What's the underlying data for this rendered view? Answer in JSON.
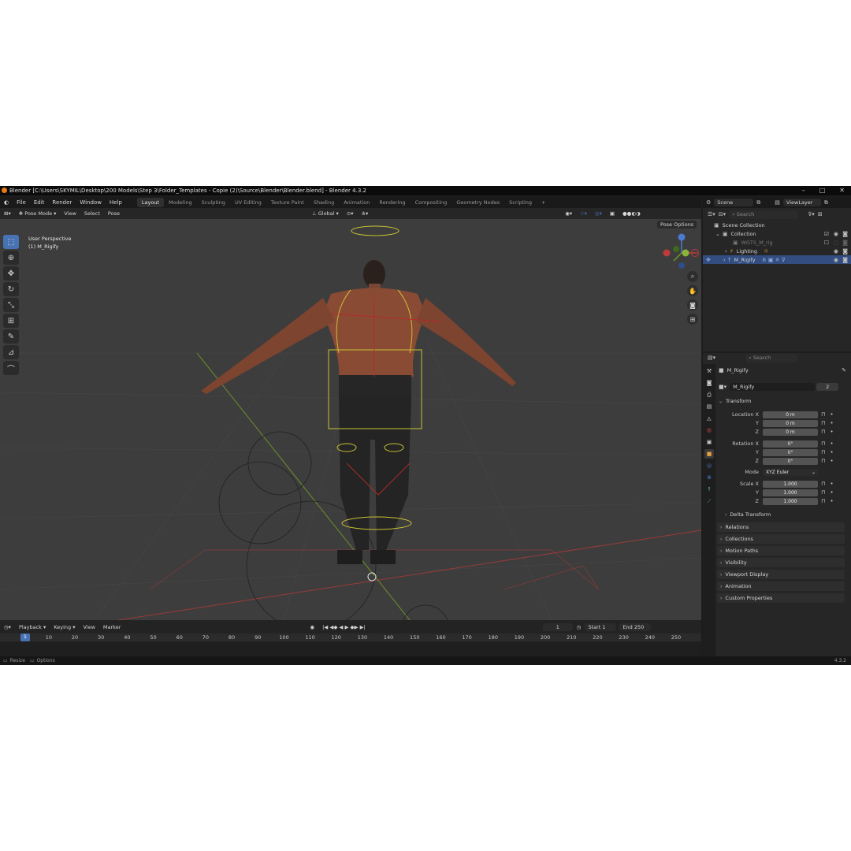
{
  "window": {
    "title": "Blender [C:\\Users\\SKYMIL\\Desktop\\200 Models\\Step 3\\Folder_Templates - Copie (2)\\Source\\Blender\\Blender.blend] - Blender 4.3.2"
  },
  "menu": [
    "File",
    "Edit",
    "Render",
    "Window",
    "Help"
  ],
  "workspaces": [
    "Layout",
    "Modeling",
    "Sculpting",
    "UV Editing",
    "Texture Paint",
    "Shading",
    "Animation",
    "Rendering",
    "Compositing",
    "Geometry Nodes",
    "Scripting"
  ],
  "scene": {
    "name": "Scene",
    "view_layer": "ViewLayer"
  },
  "header3d": {
    "mode": "Pose Mode",
    "items": [
      "View",
      "Select",
      "Pose"
    ],
    "orientation": "Global"
  },
  "viewport": {
    "perspective": "User Perspective",
    "object": "(1) M_Rigify",
    "pose_options": "Pose Options"
  },
  "outliner": {
    "search_placeholder": "Search",
    "rows": [
      "Scene Collection",
      "Collection",
      "WGTS_M_rig",
      "Lighting",
      "M_Rigify"
    ]
  },
  "properties": {
    "search_placeholder": "Search",
    "object_name": "M_Rigify",
    "data_name": "M_Rigify",
    "users": "2",
    "transform_label": "Transform",
    "location_label": "Location X",
    "rotation_label": "Rotation X",
    "scale_label": "Scale X",
    "y_label": "Y",
    "z_label": "Z",
    "mode_label": "Mode",
    "location": [
      "0 m",
      "0 m",
      "0 m"
    ],
    "rotation": [
      "0°",
      "0°",
      "0°"
    ],
    "rotation_mode": "XYZ Euler",
    "scale": [
      "1.000",
      "1.000",
      "1.000"
    ],
    "panels": [
      "Delta Transform",
      "Relations",
      "Collections",
      "Motion Paths",
      "Visibility",
      "Viewport Display",
      "Animation",
      "Custom Properties"
    ]
  },
  "timeline": {
    "menus": [
      "Playback",
      "Keying",
      "View",
      "Marker"
    ],
    "current_frame": "1",
    "start_label": "Start",
    "start": "1",
    "end_label": "End",
    "end": "250",
    "ticks": [
      "1",
      "10",
      "20",
      "30",
      "40",
      "50",
      "60",
      "70",
      "80",
      "90",
      "100",
      "110",
      "120",
      "130",
      "140",
      "150",
      "160",
      "170",
      "180",
      "190",
      "200",
      "210",
      "220",
      "230",
      "240",
      "250"
    ]
  },
  "status": {
    "resize": "Resize",
    "options": "Options",
    "version": "4.3.2"
  },
  "colors": {
    "accent": "#4772b3",
    "selected_row": "#334d80",
    "viewport_bg": "#3d3d3d"
  }
}
